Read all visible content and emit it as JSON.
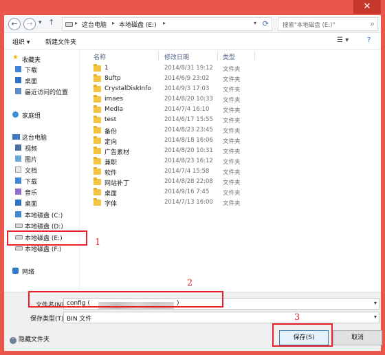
{
  "window": {
    "close_glyph": "✕",
    "close_color": "#c7382c",
    "frame_color": "#e8574a"
  },
  "nav": {
    "back_glyph": "←",
    "forward_glyph": "→",
    "recent_glyph": "▾",
    "up_glyph": "↑",
    "breadcrumb": [
      "这台电脑",
      "本地磁盘 (E:)"
    ],
    "breadcrumb_sep": "▸",
    "address_dropdown_glyph": "▾",
    "refresh_glyph": "⟳",
    "search_placeholder": "搜索\"本地磁盘 (E:)\"",
    "search_glyph": "⌕"
  },
  "toolbar": {
    "organize": "组织 ▾",
    "new_folder": "新建文件夹",
    "view_glyph": "☰ ▾",
    "help_glyph": "?"
  },
  "sidebar": {
    "favorites": "收藏夹",
    "fav_items": [
      "下载",
      "桌面",
      "最近访问的位置"
    ],
    "homegroup": "家庭组",
    "this_pc": "这台电脑",
    "pc_items": [
      "视频",
      "图片",
      "文档",
      "下载",
      "音乐",
      "桌面",
      "本地磁盘 (C:)",
      "本地磁盘 (D:)",
      "本地磁盘 (E:)",
      "本地磁盘 (F:)"
    ],
    "network": "网络"
  },
  "filelist": {
    "columns": [
      "名称",
      "修改日期",
      "类型"
    ],
    "rows": [
      {
        "name": "1",
        "date": "2014/8/31 19:12",
        "type": "文件夹"
      },
      {
        "name": "8uftp",
        "date": "2014/6/9 23:02",
        "type": "文件夹"
      },
      {
        "name": "CrystalDiskInfo",
        "date": "2014/9/3 17:03",
        "type": "文件夹"
      },
      {
        "name": "imaes",
        "date": "2014/8/20 10:33",
        "type": "文件夹"
      },
      {
        "name": "Media",
        "date": "2014/7/4 16:10",
        "type": "文件夹"
      },
      {
        "name": "test",
        "date": "2014/6/17 15:55",
        "type": "文件夹"
      },
      {
        "name": "备份",
        "date": "2014/8/23 23:45",
        "type": "文件夹"
      },
      {
        "name": "定向",
        "date": "2014/8/18 16:06",
        "type": "文件夹"
      },
      {
        "name": "广告素材",
        "date": "2014/8/20 10:31",
        "type": "文件夹"
      },
      {
        "name": "兼职",
        "date": "2014/8/23 16:12",
        "type": "文件夹"
      },
      {
        "name": "软件",
        "date": "2014/7/4 15:58",
        "type": "文件夹"
      },
      {
        "name": "网站补丁",
        "date": "2014/8/28 22:08",
        "type": "文件夹"
      },
      {
        "name": "桌面",
        "date": "2014/9/16 7:45",
        "type": "文件夹"
      },
      {
        "name": "字体",
        "date": "2014/7/13 16:00",
        "type": "文件夹"
      }
    ]
  },
  "form": {
    "filename_label": "文件名(N):",
    "filename_value_prefix": "config (",
    "filename_value_suffix": ")",
    "filetype_label": "保存类型(T):",
    "filetype_value": "BIN 文件",
    "dropdown_glyph": "▾"
  },
  "footer": {
    "hide_folders": "隐藏文件夹",
    "hide_glyph": "˄",
    "save": "保存(S)",
    "cancel": "取消"
  },
  "annotations": {
    "n1": "1",
    "n2": "2",
    "n3": "3",
    "color": "#e8212b"
  }
}
